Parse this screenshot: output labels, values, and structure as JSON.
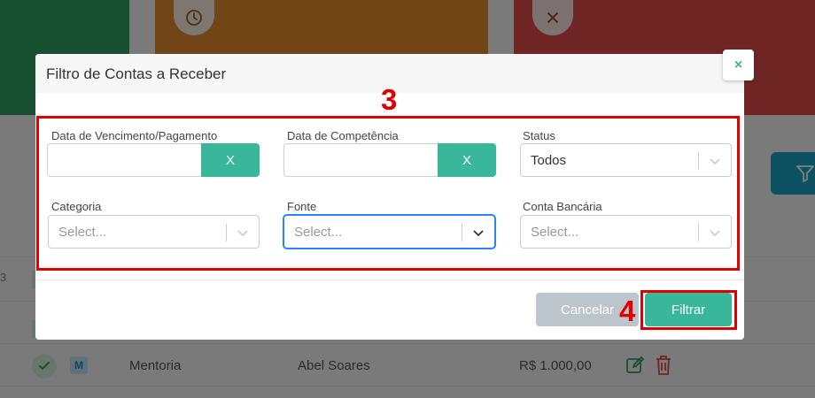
{
  "background": {
    "table_row": {
      "badge": "M",
      "category": "Mentoria",
      "client": "Abel Soares",
      "amount": "R$ 1.000,00"
    },
    "side_tag": "3",
    "colors": {
      "green": "#2e9f63",
      "orange": "#e48a2c",
      "red": "#e04a4a",
      "teal": "#1ba5c4"
    }
  },
  "modal": {
    "title": "Filtro de Contas a Receber",
    "close_label": "×",
    "fields": {
      "due_date": {
        "label": "Data de Vencimento/Pagamento",
        "value": "",
        "clear_label": "X"
      },
      "competence_date": {
        "label": "Data de Competência",
        "value": "",
        "clear_label": "X"
      },
      "status": {
        "label": "Status",
        "value": "Todos"
      },
      "category": {
        "label": "Categoria",
        "placeholder": "Select..."
      },
      "source": {
        "label": "Fonte",
        "placeholder": "Select..."
      },
      "bank_account": {
        "label": "Conta Bancária",
        "placeholder": "Select..."
      }
    },
    "buttons": {
      "cancel": "Cancelar",
      "filter": "Filtrar"
    },
    "accent_color": "#38b79b"
  },
  "annotations": {
    "fields_step": "3",
    "filter_step": "4",
    "color": "#e00000"
  }
}
